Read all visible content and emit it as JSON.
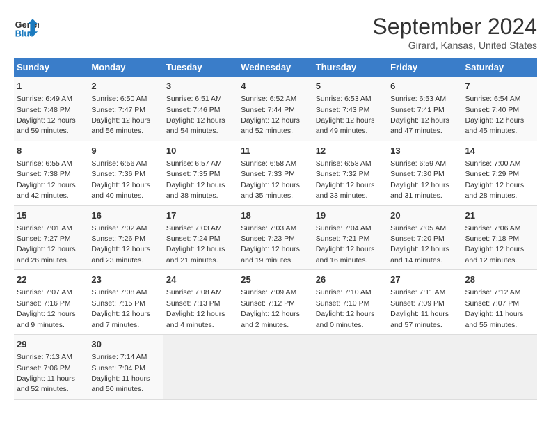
{
  "logo": {
    "line1": "General",
    "line2": "Blue"
  },
  "title": "September 2024",
  "location": "Girard, Kansas, United States",
  "days_of_week": [
    "Sunday",
    "Monday",
    "Tuesday",
    "Wednesday",
    "Thursday",
    "Friday",
    "Saturday"
  ],
  "weeks": [
    [
      {
        "num": "1",
        "sunrise": "6:49 AM",
        "sunset": "7:48 PM",
        "daylight": "12 hours and 59 minutes."
      },
      {
        "num": "2",
        "sunrise": "6:50 AM",
        "sunset": "7:47 PM",
        "daylight": "12 hours and 56 minutes."
      },
      {
        "num": "3",
        "sunrise": "6:51 AM",
        "sunset": "7:46 PM",
        "daylight": "12 hours and 54 minutes."
      },
      {
        "num": "4",
        "sunrise": "6:52 AM",
        "sunset": "7:44 PM",
        "daylight": "12 hours and 52 minutes."
      },
      {
        "num": "5",
        "sunrise": "6:53 AM",
        "sunset": "7:43 PM",
        "daylight": "12 hours and 49 minutes."
      },
      {
        "num": "6",
        "sunrise": "6:53 AM",
        "sunset": "7:41 PM",
        "daylight": "12 hours and 47 minutes."
      },
      {
        "num": "7",
        "sunrise": "6:54 AM",
        "sunset": "7:40 PM",
        "daylight": "12 hours and 45 minutes."
      }
    ],
    [
      {
        "num": "8",
        "sunrise": "6:55 AM",
        "sunset": "7:38 PM",
        "daylight": "12 hours and 42 minutes."
      },
      {
        "num": "9",
        "sunrise": "6:56 AM",
        "sunset": "7:36 PM",
        "daylight": "12 hours and 40 minutes."
      },
      {
        "num": "10",
        "sunrise": "6:57 AM",
        "sunset": "7:35 PM",
        "daylight": "12 hours and 38 minutes."
      },
      {
        "num": "11",
        "sunrise": "6:58 AM",
        "sunset": "7:33 PM",
        "daylight": "12 hours and 35 minutes."
      },
      {
        "num": "12",
        "sunrise": "6:58 AM",
        "sunset": "7:32 PM",
        "daylight": "12 hours and 33 minutes."
      },
      {
        "num": "13",
        "sunrise": "6:59 AM",
        "sunset": "7:30 PM",
        "daylight": "12 hours and 31 minutes."
      },
      {
        "num": "14",
        "sunrise": "7:00 AM",
        "sunset": "7:29 PM",
        "daylight": "12 hours and 28 minutes."
      }
    ],
    [
      {
        "num": "15",
        "sunrise": "7:01 AM",
        "sunset": "7:27 PM",
        "daylight": "12 hours and 26 minutes."
      },
      {
        "num": "16",
        "sunrise": "7:02 AM",
        "sunset": "7:26 PM",
        "daylight": "12 hours and 23 minutes."
      },
      {
        "num": "17",
        "sunrise": "7:03 AM",
        "sunset": "7:24 PM",
        "daylight": "12 hours and 21 minutes."
      },
      {
        "num": "18",
        "sunrise": "7:03 AM",
        "sunset": "7:23 PM",
        "daylight": "12 hours and 19 minutes."
      },
      {
        "num": "19",
        "sunrise": "7:04 AM",
        "sunset": "7:21 PM",
        "daylight": "12 hours and 16 minutes."
      },
      {
        "num": "20",
        "sunrise": "7:05 AM",
        "sunset": "7:20 PM",
        "daylight": "12 hours and 14 minutes."
      },
      {
        "num": "21",
        "sunrise": "7:06 AM",
        "sunset": "7:18 PM",
        "daylight": "12 hours and 12 minutes."
      }
    ],
    [
      {
        "num": "22",
        "sunrise": "7:07 AM",
        "sunset": "7:16 PM",
        "daylight": "12 hours and 9 minutes."
      },
      {
        "num": "23",
        "sunrise": "7:08 AM",
        "sunset": "7:15 PM",
        "daylight": "12 hours and 7 minutes."
      },
      {
        "num": "24",
        "sunrise": "7:08 AM",
        "sunset": "7:13 PM",
        "daylight": "12 hours and 4 minutes."
      },
      {
        "num": "25",
        "sunrise": "7:09 AM",
        "sunset": "7:12 PM",
        "daylight": "12 hours and 2 minutes."
      },
      {
        "num": "26",
        "sunrise": "7:10 AM",
        "sunset": "7:10 PM",
        "daylight": "12 hours and 0 minutes."
      },
      {
        "num": "27",
        "sunrise": "7:11 AM",
        "sunset": "7:09 PM",
        "daylight": "11 hours and 57 minutes."
      },
      {
        "num": "28",
        "sunrise": "7:12 AM",
        "sunset": "7:07 PM",
        "daylight": "11 hours and 55 minutes."
      }
    ],
    [
      {
        "num": "29",
        "sunrise": "7:13 AM",
        "sunset": "7:06 PM",
        "daylight": "11 hours and 52 minutes."
      },
      {
        "num": "30",
        "sunrise": "7:14 AM",
        "sunset": "7:04 PM",
        "daylight": "11 hours and 50 minutes."
      },
      null,
      null,
      null,
      null,
      null
    ]
  ]
}
